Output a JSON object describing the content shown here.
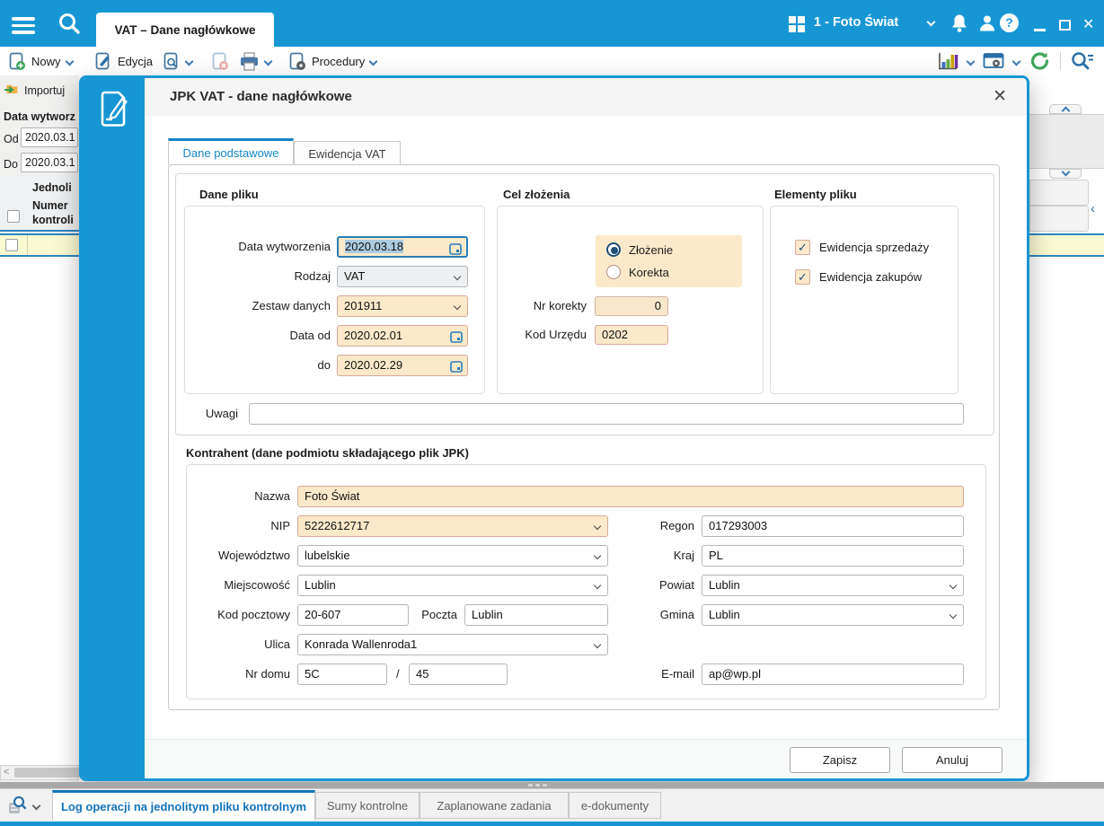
{
  "topbar": {
    "tab_title": "VAT – Dane nagłówkowe",
    "company": "1 - Foto Świat"
  },
  "toolbar": {
    "new": "Nowy",
    "edit": "Edycja",
    "procedures": "Procedury"
  },
  "background": {
    "import_label": "Importuj",
    "filter_caption": "Data wytworz",
    "from_label": "Od",
    "from_value": "2020.03.1",
    "to_label": "Do",
    "to_value": "2020.03.1",
    "header_col_top": "Jednoli",
    "header_col_mid": "Numer",
    "header_col_bot": "kontroli"
  },
  "dialog": {
    "title": "JPK VAT - dane nagłówkowe",
    "tab_basic": "Dane podstawowe",
    "tab_vat": "Ewidencja VAT",
    "file": {
      "title": "Dane pliku",
      "rows": [
        {
          "label": "Data wytworzenia",
          "value": "2020.03.18"
        },
        {
          "label": "Rodzaj",
          "value": "VAT"
        },
        {
          "label": "Zestaw danych",
          "value": "201911"
        },
        {
          "label": "Data od",
          "value": "2020.02.01"
        },
        {
          "label": "do",
          "value": "2020.02.29"
        }
      ]
    },
    "purpose": {
      "title": "Cel złożenia",
      "radio_submit": "Złożenie",
      "radio_correction": "Korekta",
      "correction_label": "Nr korekty",
      "correction_value": "0",
      "office_label": "Kod Urzędu",
      "office_value": "0202"
    },
    "elements": {
      "title": "Elementy pliku",
      "check_sales": "Ewidencja sprzedaży",
      "check_purchases": "Ewidencja zakupów"
    },
    "notes_label": "Uwagi",
    "notes_value": "",
    "contractor": {
      "title": "Kontrahent (dane podmiotu składającego plik JPK)",
      "name_label": "Nazwa",
      "name": "Foto Świat",
      "nip_label": "NIP",
      "nip": "5222612717",
      "regon_label": "Regon",
      "regon": "017293003",
      "voivodeship_label": "Województwo",
      "voivodeship": "lubelskie",
      "country_label": "Kraj",
      "country": "PL",
      "city_label": "Miejscowość",
      "city": "Lublin",
      "district_label": "Powiat",
      "district": "Lublin",
      "postal_label": "Kod pocztowy",
      "postal": "20-607",
      "post_label": "Poczta",
      "post": "Lublin",
      "commune_label": "Gmina",
      "commune": "Lublin",
      "street_label": "Ulica",
      "street": "Konrada Wallenroda1",
      "house_label": "Nr domu",
      "house": "5C",
      "slash": "/",
      "flat": "45",
      "email_label": "E-mail",
      "email": "ap@wp.pl"
    },
    "save": "Zapisz",
    "cancel": "Anuluj"
  },
  "bottombar": {
    "tabs": [
      "Log operacji na jednolitym pliku kontrolnym",
      "Sumy kontrolne",
      "Zaplanowane zadania",
      "e-dokumenty"
    ]
  },
  "colors": {
    "accent": "#1697d4",
    "field_tan": "#fbe9c9",
    "selected_row": "#fafad2",
    "active_tab_text": "#1273ba"
  }
}
